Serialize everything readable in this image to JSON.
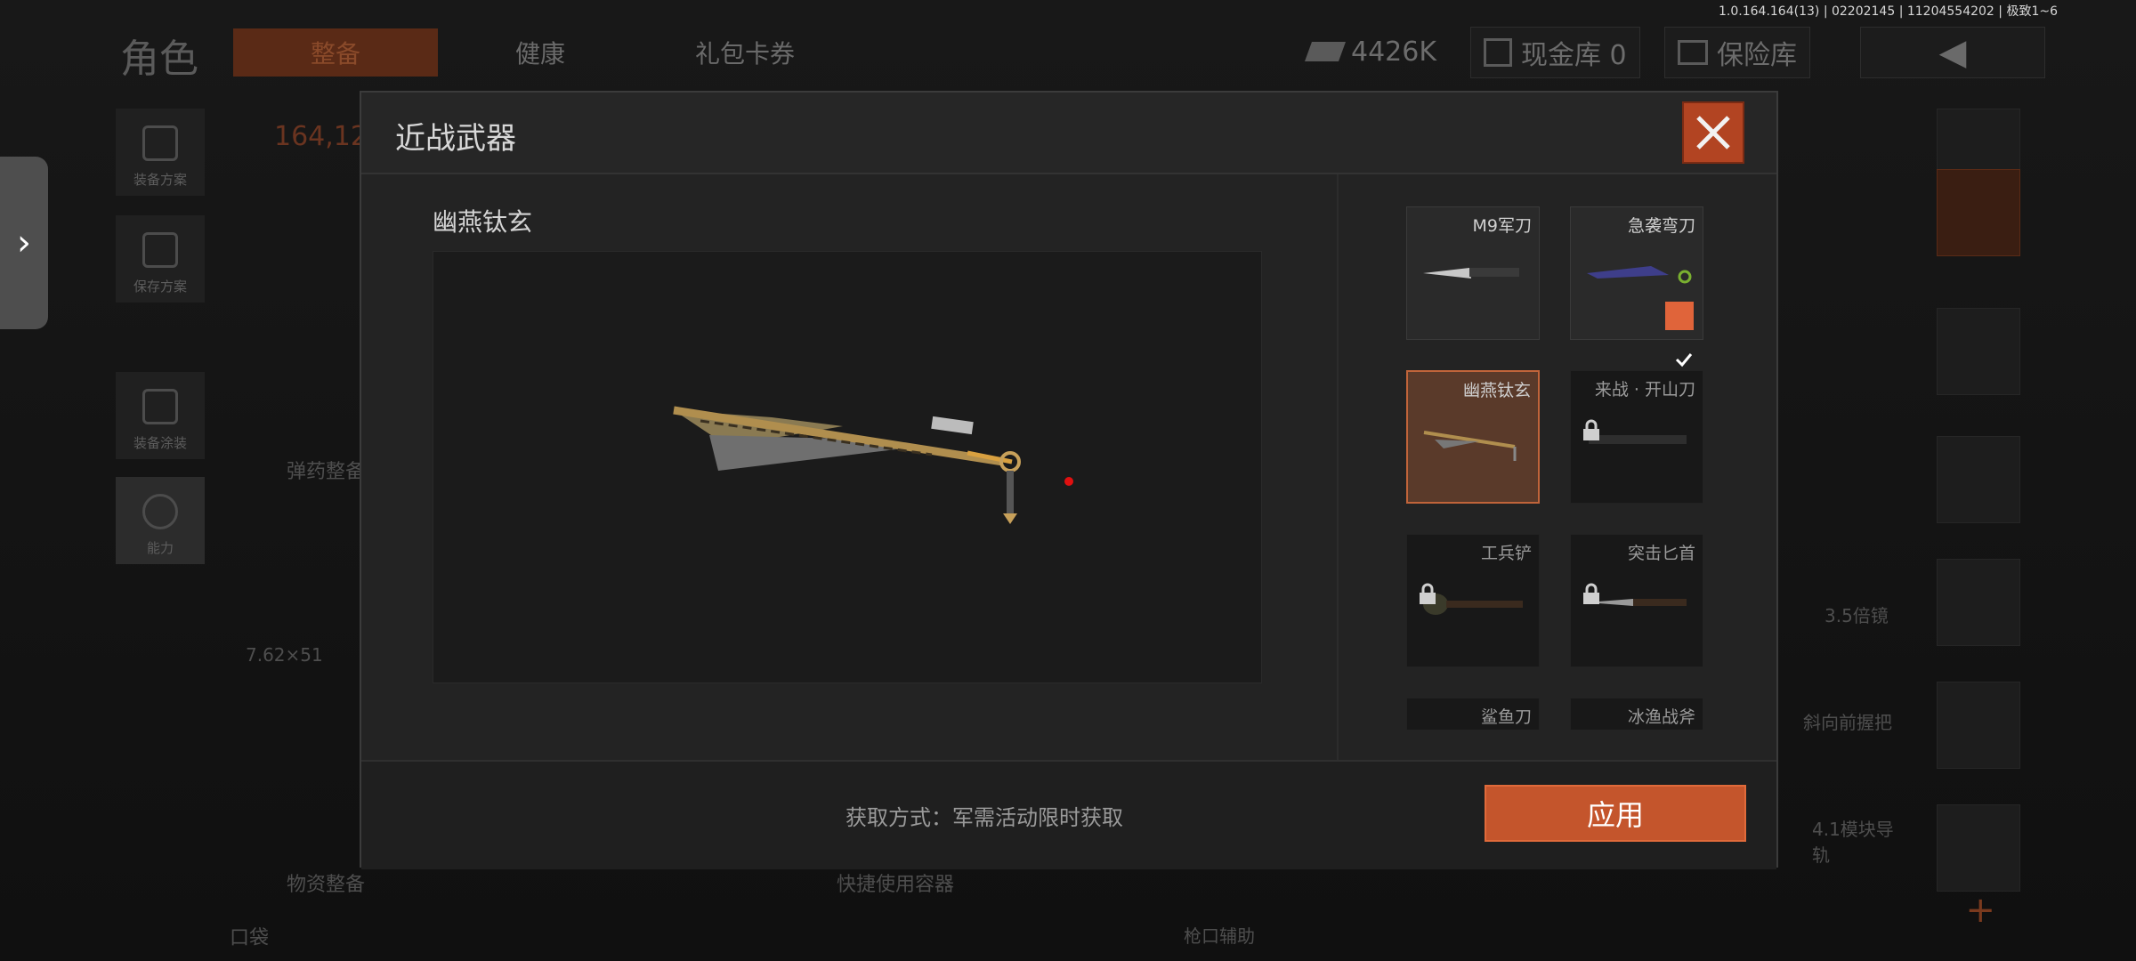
{
  "version": "1.0.164.164(13) | 02202145 | 11204554202 | 极致1~6",
  "background": {
    "title": "角色",
    "tabs": [
      "整备",
      "健康",
      "礼包卡券"
    ],
    "currency": "4426K",
    "cash_vault": "现金库 0",
    "insurance": "保险库",
    "score": "164,12",
    "side_buttons": [
      "装备方案",
      "保存方案",
      "装备涂装",
      "能力"
    ],
    "ammo_label": "弹药整备",
    "ammo_caliber": "7.62×51",
    "supplies_label": "物资整备",
    "quick_container": "快捷使用容器",
    "pocket": "口袋",
    "scope": "3.5倍镜",
    "grip": "斜向前握把",
    "rail": "4.1模块导轨",
    "muzzle": "枪口辅助"
  },
  "modal": {
    "title": "近战武器",
    "selected_weapon_name": "幽燕钛玄",
    "acquire_text": "获取方式：军需活动限时获取",
    "apply_label": "应用",
    "items": [
      {
        "label": "M9军刀",
        "state": "owned",
        "equipped": false
      },
      {
        "label": "急袭弯刀",
        "state": "owned",
        "equipped": true
      },
      {
        "label": "幽燕钛玄",
        "state": "selected",
        "equipped": false
      },
      {
        "label": "来战 · 开山刀",
        "state": "locked",
        "equipped": false
      },
      {
        "label": "工兵铲",
        "state": "locked",
        "equipped": false
      },
      {
        "label": "突击匕首",
        "state": "locked",
        "equipped": false
      },
      {
        "label": "鲨鱼刀",
        "state": "locked",
        "equipped": false
      },
      {
        "label": "冰渔战斧",
        "state": "locked",
        "equipped": false
      }
    ]
  },
  "colors": {
    "accent": "#c4552c",
    "close": "#b24422",
    "check": "#e0643a"
  }
}
